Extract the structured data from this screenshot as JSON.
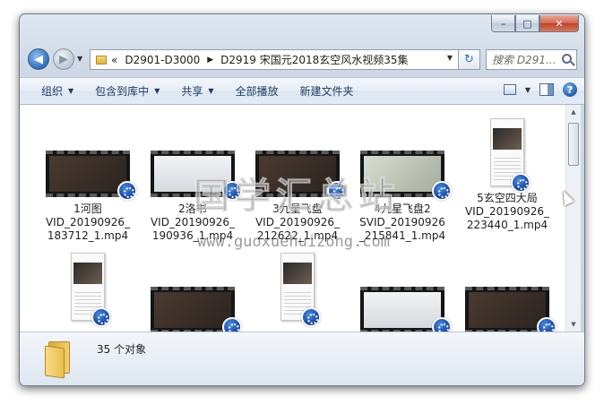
{
  "window": {
    "caption": {
      "minimize": "–",
      "maximize": "□",
      "close": "✕"
    }
  },
  "address": {
    "overflow": "«",
    "segments": [
      "D2901-D3000",
      "D2919 宋国元2018玄空风水视频35集"
    ],
    "separator": "▶",
    "search_placeholder": "搜索 D291..."
  },
  "toolbar": {
    "items": [
      {
        "label": "组织",
        "dropdown": true
      },
      {
        "label": "包含到库中",
        "dropdown": true
      },
      {
        "label": "共享",
        "dropdown": true
      },
      {
        "label": "全部播放",
        "dropdown": false
      },
      {
        "label": "新建文件夹",
        "dropdown": false
      }
    ],
    "help_label": "?"
  },
  "files": [
    {
      "name": "1河图\nVID_20190926_\n183712_1.mp4",
      "thumb": "land",
      "screen": "dark"
    },
    {
      "name": "2洛书\nVID_20190926_\n190936_1.mp4",
      "thumb": "land",
      "screen": "lite"
    },
    {
      "name": "3九星飞盘\nVID_20190926_\n212622_1.mp4",
      "thumb": "land",
      "screen": "dark"
    },
    {
      "name": "4九星飞盘2\nSVID_20190926\n_215841_1.mp4",
      "thumb": "land",
      "screen": "board"
    },
    {
      "name": "5玄空四大局\nVID_20190926_\n223440_1.mp4",
      "thumb": "port"
    },
    {
      "name": "",
      "thumb": "port"
    },
    {
      "name": "",
      "thumb": "land",
      "screen": "dark"
    },
    {
      "name": "",
      "thumb": "port"
    },
    {
      "name": "",
      "thumb": "land",
      "screen": "lite"
    },
    {
      "name": "",
      "thumb": "land",
      "screen": "dark"
    }
  ],
  "watermark": {
    "text": "国学汇总站",
    "url": "www.guoxuehuizong.com"
  },
  "status": {
    "count": "35 个对象"
  }
}
